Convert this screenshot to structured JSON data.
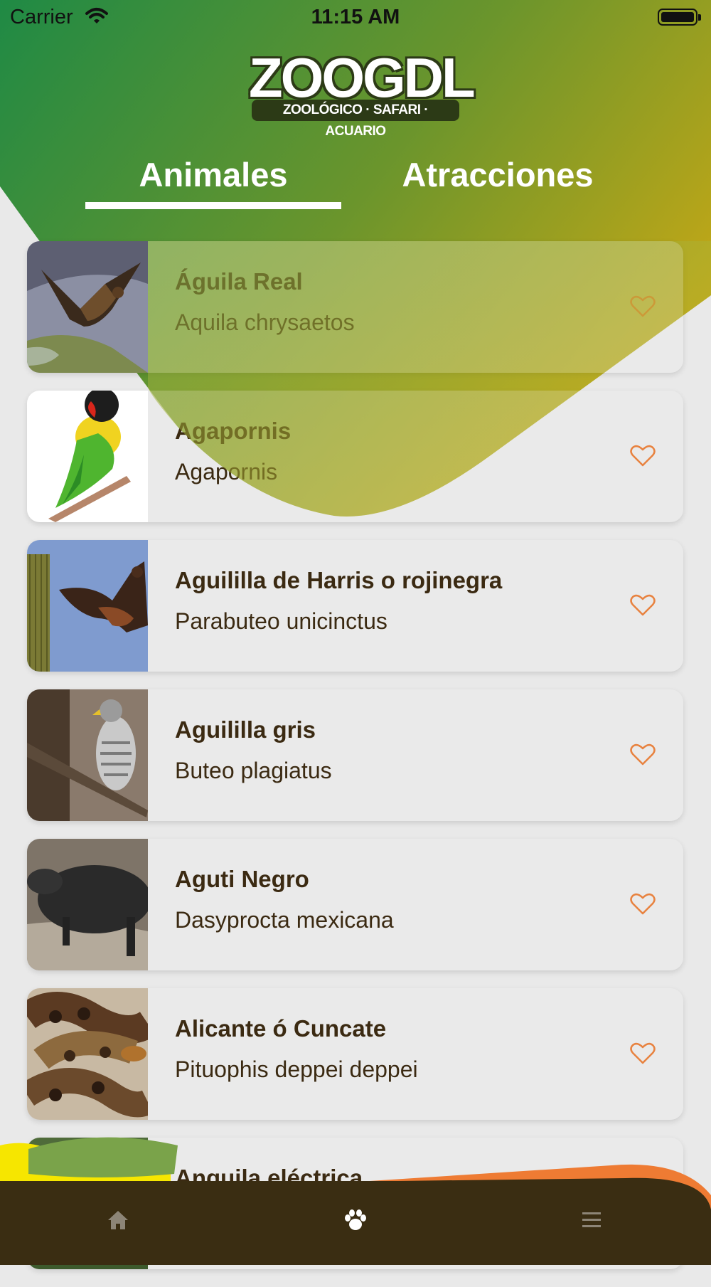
{
  "status_bar": {
    "carrier": "Carrier",
    "time": "11:15 AM"
  },
  "logo": {
    "wordmark": "ZOOGDL",
    "tagline": "ZOOLÓGICO · SAFARI · ACUARIO"
  },
  "tabs": [
    {
      "label": "Animales",
      "selected": true
    },
    {
      "label": "Atracciones",
      "selected": false
    }
  ],
  "animals": [
    {
      "name": " Águila Real",
      "scientific": "Aquila chrysaetos"
    },
    {
      "name": "Agapornis",
      "scientific": "Agapornis"
    },
    {
      "name": "Aguililla de Harris o rojinegra",
      "scientific": "Parabuteo unicinctus"
    },
    {
      "name": "Aguililla gris",
      "scientific": "Buteo plagiatus"
    },
    {
      "name": "Aguti Negro",
      "scientific": "Dasyprocta mexicana"
    },
    {
      "name": "Alicante ó Cuncate",
      "scientific": "Pituophis deppei deppei"
    },
    {
      "name": "Anguila eléctrica",
      "scientific": ""
    }
  ],
  "bottom_nav": [
    {
      "icon": "home-icon",
      "active": false
    },
    {
      "icon": "paw-icon",
      "active": true
    },
    {
      "icon": "menu-icon",
      "active": false
    }
  ],
  "colors": {
    "header_green": "#1f8a45",
    "header_yellow": "#b9a81a",
    "brown": "#3b2a12",
    "heart": "#e8823f",
    "orange_accent": "#ee7b33",
    "nav_bg": "#3a2d12"
  }
}
